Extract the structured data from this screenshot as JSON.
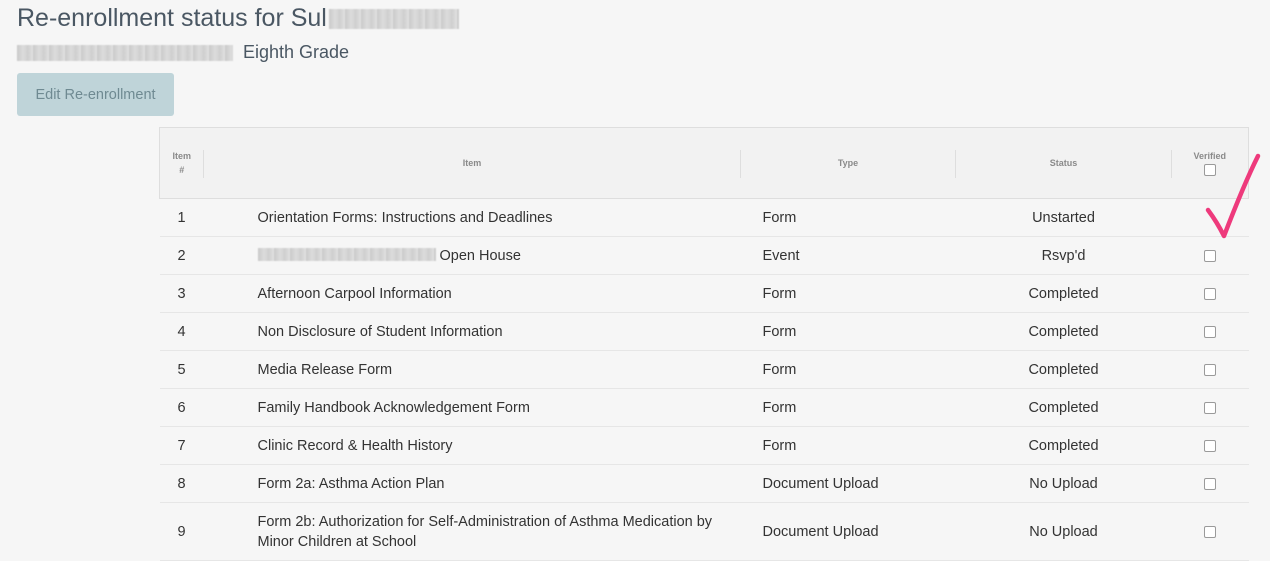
{
  "header": {
    "title": "Re-enrollment status for Sul",
    "grade": "Eighth Grade"
  },
  "actions": {
    "edit_label": "Edit Re-enrollment"
  },
  "table": {
    "columns": {
      "num": "Item #",
      "item": "Item",
      "type": "Type",
      "status": "Status",
      "verified": "Verified"
    },
    "rows": [
      {
        "num": "1",
        "item": "Orientation Forms: Instructions and Deadlines",
        "type": "Form",
        "status": "Unstarted"
      },
      {
        "num": "2",
        "item": "Open House",
        "type": "Event",
        "status": "Rsvp'd"
      },
      {
        "num": "3",
        "item": "Afternoon Carpool Information",
        "type": "Form",
        "status": "Completed"
      },
      {
        "num": "4",
        "item": "Non Disclosure of Student Information",
        "type": "Form",
        "status": "Completed"
      },
      {
        "num": "5",
        "item": "Media Release Form",
        "type": "Form",
        "status": "Completed"
      },
      {
        "num": "6",
        "item": "Family Handbook Acknowledgement Form",
        "type": "Form",
        "status": "Completed"
      },
      {
        "num": "7",
        "item": "Clinic Record & Health History",
        "type": "Form",
        "status": "Completed"
      },
      {
        "num": "8",
        "item": "Form 2a: Asthma Action Plan",
        "type": "Document Upload",
        "status": "No Upload"
      },
      {
        "num": "9",
        "item": "Form 2b: Authorization for Self-Administration of Asthma Medication by Minor Children at School",
        "type": "Document Upload",
        "status": "No Upload"
      }
    ]
  },
  "annotation": {
    "checkmark_color": "#ee3a7c"
  }
}
